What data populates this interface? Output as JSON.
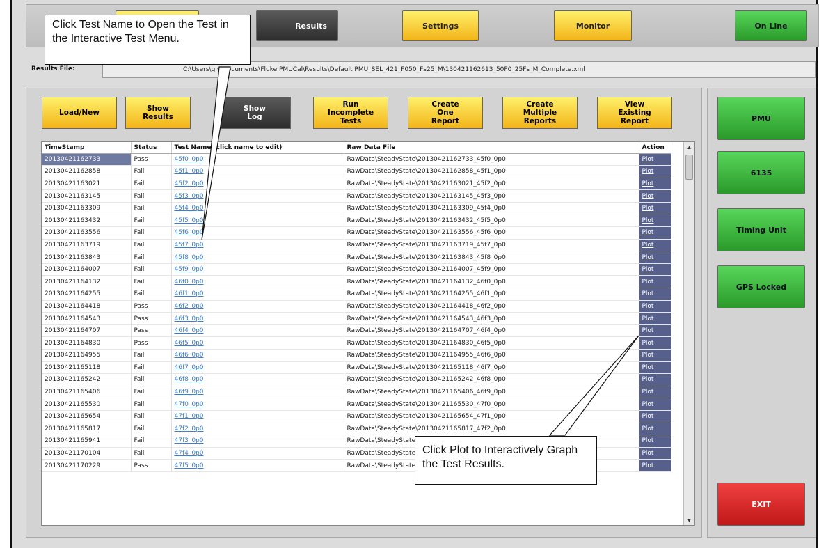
{
  "top_nav": {
    "results_tab": "Results",
    "settings": "Settings",
    "monitor": "Monitor",
    "on_line": "On Line"
  },
  "results_file": {
    "label": "Results File:",
    "path": "C:\\Users\\giv   Documents\\Fluke PMUCal\\Results\\Default PMU_SEL_421_F050_Fs25_M\\130421162613_50F0_25Fs_M_Complete.xml"
  },
  "actions": {
    "load_new": "Load/New",
    "show_results": "Show Results",
    "show_log": "Show Log",
    "run_incomplete": "Run Incomplete Tests",
    "create_one": "Create One Report",
    "create_multiple": "Create Multiple Reports",
    "view_existing": "View Existing Report"
  },
  "side": {
    "pmu": "PMU",
    "n6135": "6135",
    "timing": "Timing Unit",
    "gps": "GPS Locked",
    "exit": "EXIT"
  },
  "table": {
    "columns": [
      "TimeStamp",
      "Status",
      "Test Name (click name to edit)",
      "Raw Data File",
      "Action"
    ],
    "rows": [
      [
        "20130421162733",
        "Pass",
        "45f0_0p0",
        "RawData\\SteadyState\\20130421162733_45f0_0p0",
        "Plot"
      ],
      [
        "20130421162858",
        "Fail",
        "45f1_0p0",
        "RawData\\SteadyState\\20130421162858_45f1_0p0",
        "Plot"
      ],
      [
        "20130421163021",
        "Fail",
        "45f2_0p0",
        "RawData\\SteadyState\\20130421163021_45f2_0p0",
        "Plot"
      ],
      [
        "20130421163145",
        "Fail",
        "45f3_0p0",
        "RawData\\SteadyState\\20130421163145_45f3_0p0",
        "Plot"
      ],
      [
        "20130421163309",
        "Fail",
        "45f4_0p0",
        "RawData\\SteadyState\\20130421163309_45f4_0p0",
        "Plot"
      ],
      [
        "20130421163432",
        "Fail",
        "45f5_0p0",
        "RawData\\SteadyState\\20130421163432_45f5_0p0",
        "Plot"
      ],
      [
        "20130421163556",
        "Fail",
        "45f6_0p0",
        "RawData\\SteadyState\\20130421163556_45f6_0p0",
        "Plot"
      ],
      [
        "20130421163719",
        "Fail",
        "45f7_0p0",
        "RawData\\SteadyState\\20130421163719_45f7_0p0",
        "Plot"
      ],
      [
        "20130421163843",
        "Fail",
        "45f8_0p0",
        "RawData\\SteadyState\\20130421163843_45f8_0p0",
        "Plot"
      ],
      [
        "20130421164007",
        "Fail",
        "45f9_0p0",
        "RawData\\SteadyState\\20130421164007_45f9_0p0",
        "Plot"
      ],
      [
        "20130421164132",
        "Fail",
        "46f0_0p0",
        "RawData\\SteadyState\\20130421164132_46f0_0p0",
        "Plot"
      ],
      [
        "20130421164255",
        "Fail",
        "46f1_0p0",
        "RawData\\SteadyState\\20130421164255_46f1_0p0",
        "Plot"
      ],
      [
        "20130421164418",
        "Pass",
        "46f2_0p0",
        "RawData\\SteadyState\\20130421164418_46f2_0p0",
        "Plot"
      ],
      [
        "20130421164543",
        "Pass",
        "46f3_0p0",
        "RawData\\SteadyState\\20130421164543_46f3_0p0",
        "Plot"
      ],
      [
        "20130421164707",
        "Pass",
        "46f4_0p0",
        "RawData\\SteadyState\\20130421164707_46f4_0p0",
        "Plot"
      ],
      [
        "20130421164830",
        "Pass",
        "46f5_0p0",
        "RawData\\SteadyState\\20130421164830_46f5_0p0",
        "Plot"
      ],
      [
        "20130421164955",
        "Fail",
        "46f6_0p0",
        "RawData\\SteadyState\\20130421164955_46f6_0p0",
        "Plot"
      ],
      [
        "20130421165118",
        "Fail",
        "46f7_0p0",
        "RawData\\SteadyState\\20130421165118_46f7_0p0",
        "Plot"
      ],
      [
        "20130421165242",
        "Fail",
        "46f8_0p0",
        "RawData\\SteadyState\\20130421165242_46f8_0p0",
        "Plot"
      ],
      [
        "20130421165406",
        "Fail",
        "46f9_0p0",
        "RawData\\SteadyState\\20130421165406_46f9_0p0",
        "Plot"
      ],
      [
        "20130421165530",
        "Fail",
        "47f0_0p0",
        "RawData\\SteadyState\\20130421165530_47f0_0p0",
        "Plot"
      ],
      [
        "20130421165654",
        "Fail",
        "47f1_0p0",
        "RawData\\SteadyState\\20130421165654_47f1_0p0",
        "Plot"
      ],
      [
        "20130421165817",
        "Fail",
        "47f2_0p0",
        "RawData\\SteadyState\\20130421165817_47f2_0p0",
        "Plot"
      ],
      [
        "20130421165941",
        "Fail",
        "47f3_0p0",
        "RawData\\SteadyState\\20130421165941_47f3_0p0",
        "Plot"
      ],
      [
        "20130421170104",
        "Fail",
        "47f4_0p0",
        "RawData\\SteadyState\\20130421170104_47f4_0p0",
        "Plot"
      ],
      [
        "20130421170229",
        "Pass",
        "47f5_0p0",
        "RawData\\SteadyState\\20130421170229_47f5_0p0",
        "Plot"
      ]
    ]
  },
  "callouts": {
    "test_name": "Click Test Name to Open the Test in the Interactive Test Menu.",
    "plot": "Click Plot to Interactively Graph the Test Results."
  }
}
